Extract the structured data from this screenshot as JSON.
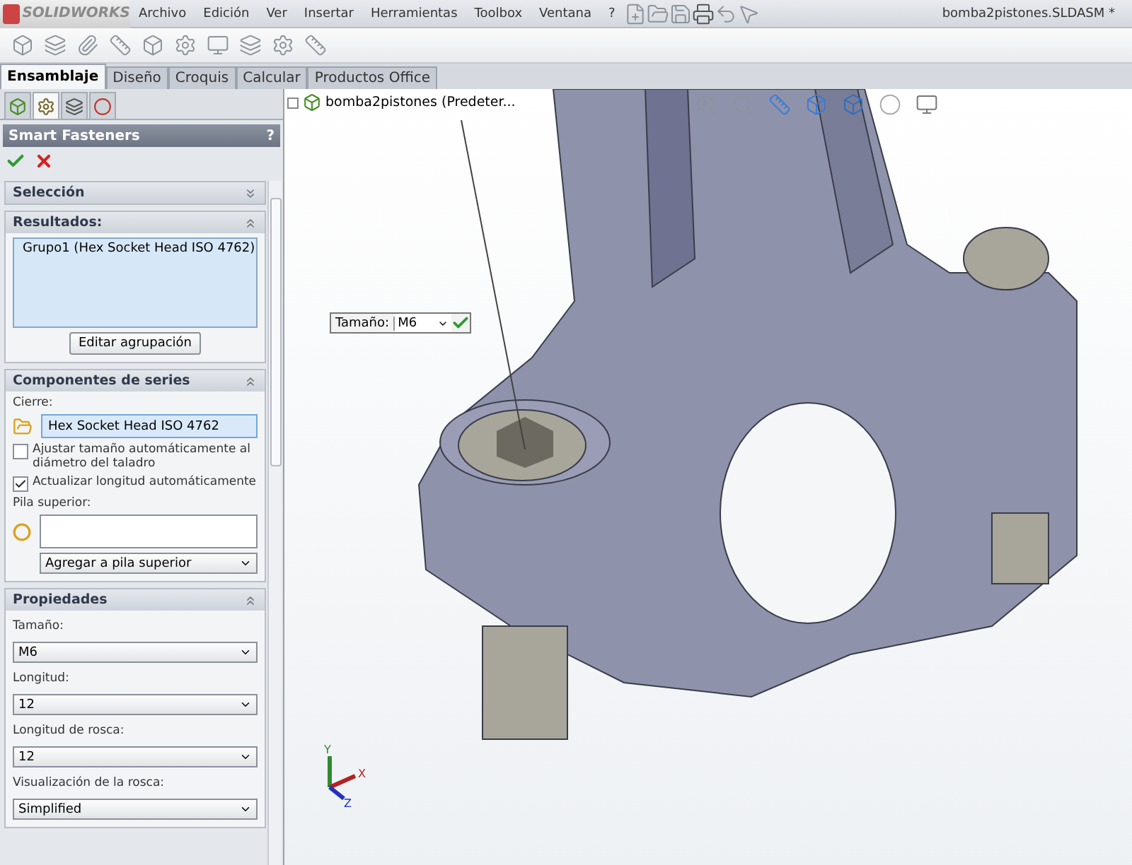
{
  "app": {
    "logo": "SOLIDWORKS",
    "menu": [
      "Archivo",
      "Edición",
      "Ver",
      "Insertar",
      "Herramientas",
      "Toolbox",
      "Ventana",
      "?"
    ],
    "document_title": "bomba2pistones.SLDASM *"
  },
  "command_tabs": [
    {
      "label": "Ensamblaje",
      "selected": true
    },
    {
      "label": "Diseño",
      "selected": false
    },
    {
      "label": "Croquis",
      "selected": false
    },
    {
      "label": "Calcular",
      "selected": false
    },
    {
      "label": "Productos Office",
      "selected": false
    }
  ],
  "panel_tabs": [
    {
      "selected": false
    },
    {
      "selected": true
    },
    {
      "selected": false
    },
    {
      "selected": false
    }
  ],
  "tree": {
    "root": "bomba2pistones  (Predeter..."
  },
  "property_manager": {
    "title": "Smart Fasteners",
    "help": "?",
    "sections": [
      {
        "kind": "empty",
        "title": "Selección",
        "expanded": false
      },
      {
        "kind": "results",
        "title": "Resultados:",
        "expanded": true,
        "items": [
          "Grupo1 (Hex Socket Head ISO 4762)"
        ],
        "button": "Editar agrupación"
      },
      {
        "kind": "series",
        "title": "Componentes de series",
        "expanded": true,
        "fastener_label": "Cierre:",
        "fastener_value": "Hex Socket Head ISO 4762",
        "options": [
          {
            "label": "Ajustar tamaño automáticamente al diámetro del taladro",
            "checked": false
          },
          {
            "label": "Actualizar longitud automáticamente",
            "checked": true
          }
        ],
        "stack_label": "Pila superior:",
        "stack_dropdown": "Agregar a pila superior"
      },
      {
        "kind": "properties",
        "title": "Propiedades",
        "expanded": true,
        "fields": [
          {
            "label": "Tamaño:",
            "value": "M6"
          },
          {
            "label": "Longitud:",
            "value": "12"
          },
          {
            "label": "Longitud de rosca:",
            "value": "12"
          },
          {
            "label": "Visualización de la rosca:",
            "value": "Simplified"
          }
        ]
      }
    ]
  },
  "callout": {
    "label": "Tamaño:",
    "value": "M6"
  },
  "triad": {
    "x": "X",
    "y": "Y",
    "z": "Z"
  }
}
